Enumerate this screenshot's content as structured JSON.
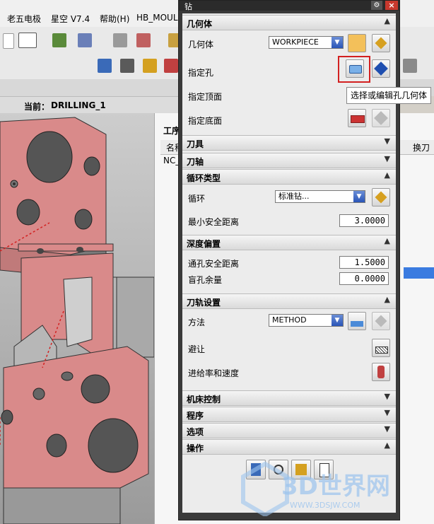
{
  "app": {
    "menu": [
      "老五电极",
      "星空 V7.4",
      "帮助(H)",
      "HB_MOULI"
    ],
    "current_op_label": "当前：",
    "current_op_value": "DRILLING_1",
    "nav": {
      "header_partial": "工序",
      "col_name": "名称",
      "col_tool_change": "换刀",
      "row_prefix": "NC_"
    }
  },
  "dialog": {
    "title": "钻",
    "sections": {
      "geometry": {
        "title": "几何体",
        "geometry_label": "几何体",
        "geometry_value": "WORKPIECE",
        "specify_holes_label": "指定孔",
        "specify_top_label": "指定顶面",
        "specify_bottom_label": "指定底面"
      },
      "tool": {
        "title": "刀具"
      },
      "axis": {
        "title": "刀轴"
      },
      "cycle": {
        "title": "循环类型",
        "cycle_label": "循环",
        "cycle_value": "标准钻...",
        "min_clearance_label": "最小安全距离",
        "min_clearance_value": "3.0000"
      },
      "depth": {
        "title": "深度偏置",
        "through_label": "通孔安全距离",
        "through_value": "1.5000",
        "blind_label": "盲孔余量",
        "blind_value": "0.0000"
      },
      "path": {
        "title": "刀轨设置",
        "method_label": "方法",
        "method_value": "METHOD",
        "avoid_label": "避让",
        "feeds_label": "进给率和速度"
      },
      "machine": {
        "title": "机床控制"
      },
      "program": {
        "title": "程序"
      },
      "options": {
        "title": "选项"
      },
      "actions": {
        "title": "操作"
      }
    },
    "tooltip": "选择或编辑孔几何体"
  },
  "watermark": {
    "text": "3D世界网",
    "url": "WWW.3DSJW.COM"
  },
  "colors": {
    "part_fill": "#d98a8a",
    "highlight": "#d32020",
    "dialog_bg": "#ececec"
  }
}
